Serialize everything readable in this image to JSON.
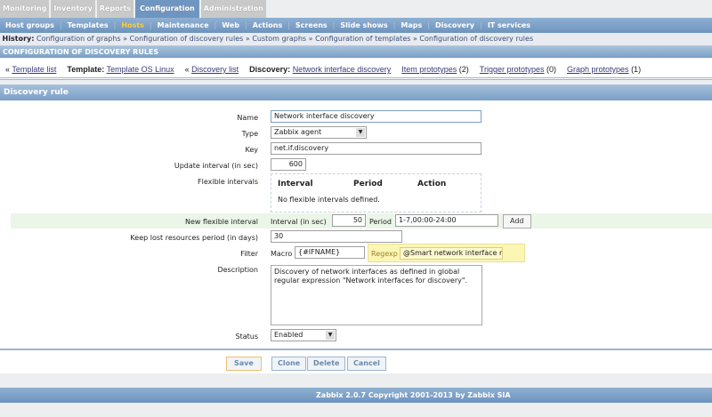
{
  "top_tabs": [
    "Monitoring",
    "Inventory",
    "Reports",
    "Configuration",
    "Administration"
  ],
  "sub_menu": [
    "Host groups",
    "Templates",
    "Hosts",
    "Maintenance",
    "Web",
    "Actions",
    "Screens",
    "Slide shows",
    "Maps",
    "Discovery",
    "IT services"
  ],
  "history": {
    "label": "History:",
    "items": [
      "Configuration of graphs",
      "Configuration of discovery rules",
      "Custom graphs",
      "Configuration of templates",
      "Configuration of discovery rules"
    ]
  },
  "page_title": "CONFIGURATION OF DISCOVERY RULES",
  "links": {
    "template_list": "Template list",
    "template_label": "Template:",
    "template": "Template OS Linux",
    "discovery_list": "Discovery list",
    "discovery_label": "Discovery:",
    "discovery": "Network interface discovery",
    "item_prototypes": "Item prototypes",
    "item_count": "(2)",
    "trigger_prototypes": "Trigger prototypes",
    "trigger_count": "(0)",
    "graph_prototypes": "Graph prototypes",
    "graph_count": "(1)"
  },
  "section_title": "Discovery rule",
  "form": {
    "name_label": "Name",
    "name": "Network interface discovery",
    "type_label": "Type",
    "type": "Zabbix agent",
    "key_label": "Key",
    "key": "net.if.discovery",
    "update_label": "Update interval (in sec)",
    "update": "600",
    "flex_label": "Flexible intervals",
    "flex_cols": [
      "Interval",
      "Period",
      "Action"
    ],
    "flex_empty": "No flexible intervals defined.",
    "newflex_label": "New flexible interval",
    "interval_label": "Interval (in sec)",
    "interval": "50",
    "period_label": "Period",
    "period": "1-7,00:00-24:00",
    "add": "Add",
    "keep_label": "Keep lost resources period (in days)",
    "keep": "30",
    "filter_label": "Filter",
    "macro_label": "Macro",
    "macro": "{#IFNAME}",
    "regexp_label": "Regexp",
    "regexp": "@Smart network interface names for discovery",
    "desc_label": "Description",
    "desc": "Discovery of network interfaces as defined in global regular expression \"Network interfaces for discovery\".",
    "status_label": "Status",
    "status": "Enabled"
  },
  "buttons": {
    "save": "Save",
    "clone": "Clone",
    "delete": "Delete",
    "cancel": "Cancel"
  },
  "footer": "Zabbix 2.0.7 Copyright 2001-2013 by Zabbix SIA"
}
